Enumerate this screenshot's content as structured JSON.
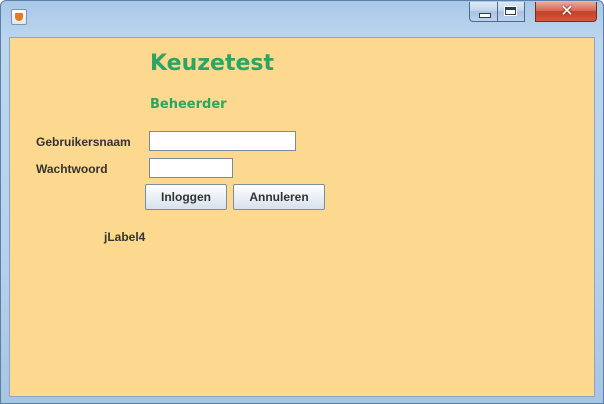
{
  "window": {
    "icon": "java-cup-icon",
    "title": "",
    "controls": {
      "minimize": "minimize-icon",
      "maximize": "maximize-icon",
      "close_label": "✕"
    }
  },
  "form": {
    "title": "Keuzetest",
    "subtitle": "Beheerder",
    "username_label": "Gebruikersnaam",
    "username_value": "",
    "password_label": "Wachtwoord",
    "password_value": "",
    "login_button": "Inloggen",
    "cancel_button": "Annuleren",
    "status_label": "jLabel4"
  },
  "colors": {
    "background": "#fdd98f",
    "heading": "#2ca564",
    "text": "#333333",
    "close_button": "#c2412a"
  }
}
